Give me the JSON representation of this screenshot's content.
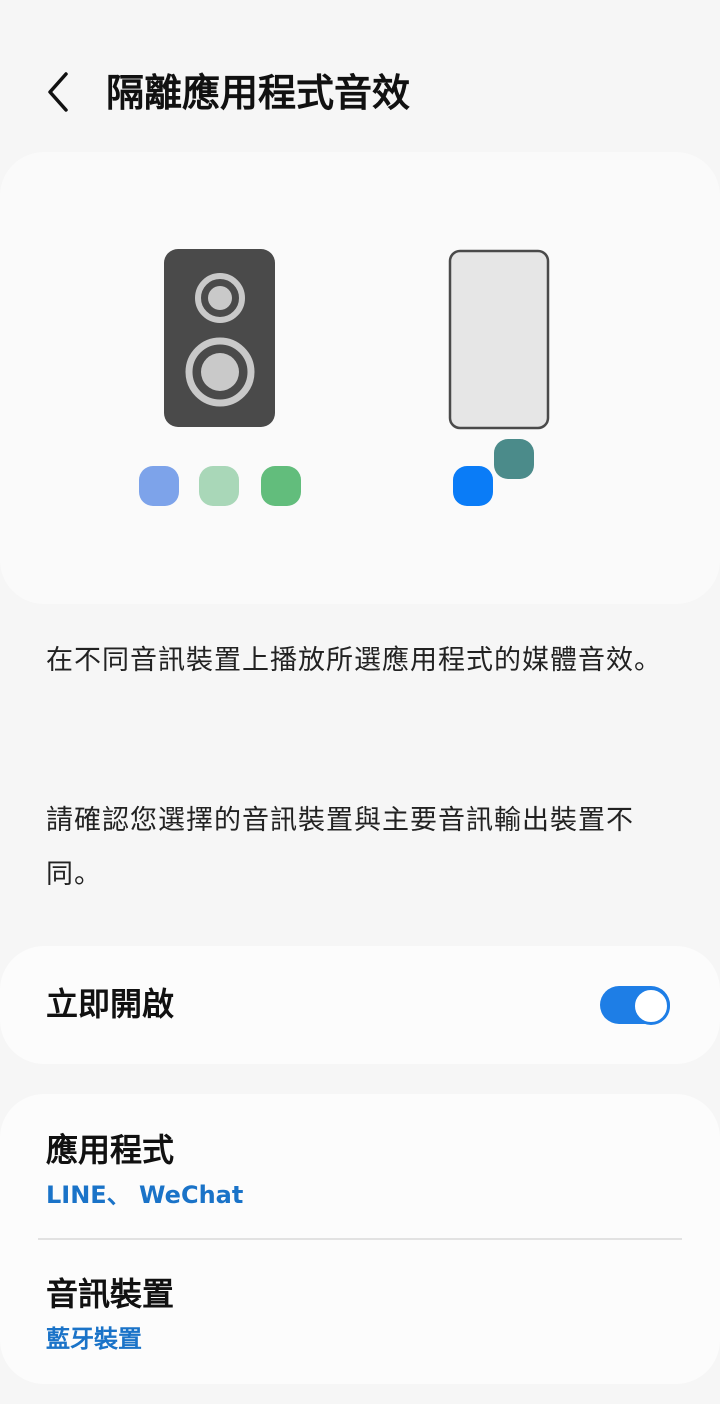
{
  "header": {
    "title": "隔離應用程式音效",
    "back_icon": "chevron-left-icon"
  },
  "illustration": {
    "dots_left_colors": [
      "#7da3ea",
      "#a9d7b8",
      "#62bd7c"
    ],
    "dots_right_colors": [
      "#0a7cf7",
      "#4b8b8a"
    ],
    "speaker_color": "#4a4a4a",
    "phone_color": "#e6e6e6"
  },
  "description": {
    "paragraph_1": "在不同音訊裝置上播放所選應用程式的媒體音效。",
    "paragraph_2": "請確認您選擇的音訊裝置與主要音訊輸出裝置不同。"
  },
  "toggle_setting": {
    "label": "立即開啟",
    "enabled": true,
    "accent_color": "#1e7ee6"
  },
  "settings": {
    "apps": {
      "title": "應用程式",
      "value": "LINE、 WeChat"
    },
    "audio_device": {
      "title": "音訊裝置",
      "value": "藍牙裝置"
    }
  }
}
